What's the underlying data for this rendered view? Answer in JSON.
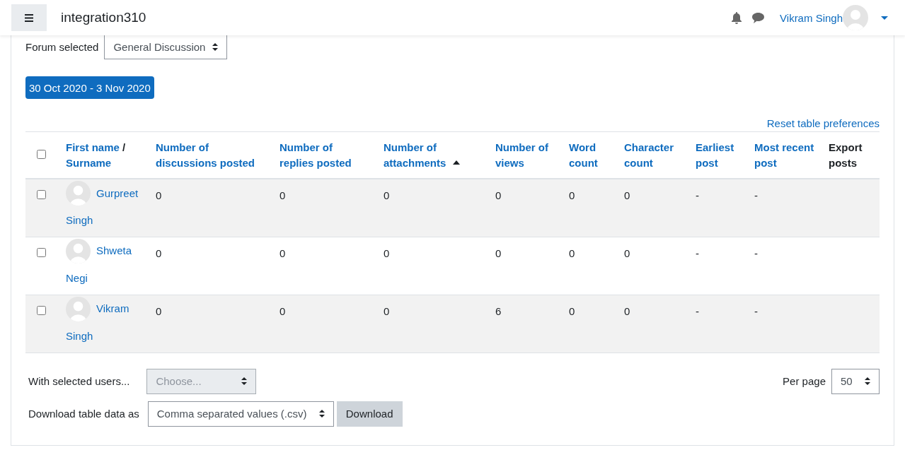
{
  "header": {
    "site_name": "integration310",
    "user_name": "Vikram Singh"
  },
  "forum_select": {
    "label": "Forum selected",
    "value": "General Discussion"
  },
  "date_range": "30 Oct 2020 - 3 Nov 2020",
  "reset_link": "Reset table preferences",
  "table": {
    "select_all": {
      "checked": false
    },
    "name_column": {
      "first": "First name",
      "separator": "/",
      "last": "Surname"
    },
    "columns": [
      {
        "label": "Number of discussions posted",
        "kind": "link",
        "sorted": false
      },
      {
        "label": "Number of replies posted",
        "kind": "link",
        "sorted": false
      },
      {
        "label": "Number of attachments",
        "kind": "link",
        "sorted": true
      },
      {
        "label": "Number of views",
        "kind": "link",
        "sorted": false
      },
      {
        "label": "Word count",
        "kind": "link",
        "sorted": false
      },
      {
        "label": "Character count",
        "kind": "link",
        "sorted": false
      },
      {
        "label": "Earliest post",
        "kind": "link",
        "sorted": false
      },
      {
        "label": "Most recent post",
        "kind": "link",
        "sorted": false
      },
      {
        "label": "Export posts",
        "kind": "plain",
        "sorted": false
      }
    ],
    "rows": [
      {
        "checked": false,
        "first_name": "Gurpreet",
        "last_name": "Singh",
        "values": [
          "0",
          "0",
          "0",
          "0",
          "0",
          "0",
          "-",
          "-"
        ]
      },
      {
        "checked": false,
        "first_name": "Shweta",
        "last_name": "Negi",
        "values": [
          "0",
          "0",
          "0",
          "0",
          "0",
          "0",
          "-",
          "-"
        ]
      },
      {
        "checked": false,
        "first_name": "Vikram",
        "last_name": "Singh",
        "values": [
          "0",
          "0",
          "0",
          "6",
          "0",
          "0",
          "-",
          "-"
        ]
      }
    ]
  },
  "bulk_action": {
    "label": "With selected users...",
    "placeholder": "Choose...",
    "disabled": true
  },
  "per_page": {
    "label": "Per page",
    "value": "50"
  },
  "download": {
    "label": "Download table data as",
    "format": "Comma separated values (.csv)",
    "button": "Download"
  }
}
